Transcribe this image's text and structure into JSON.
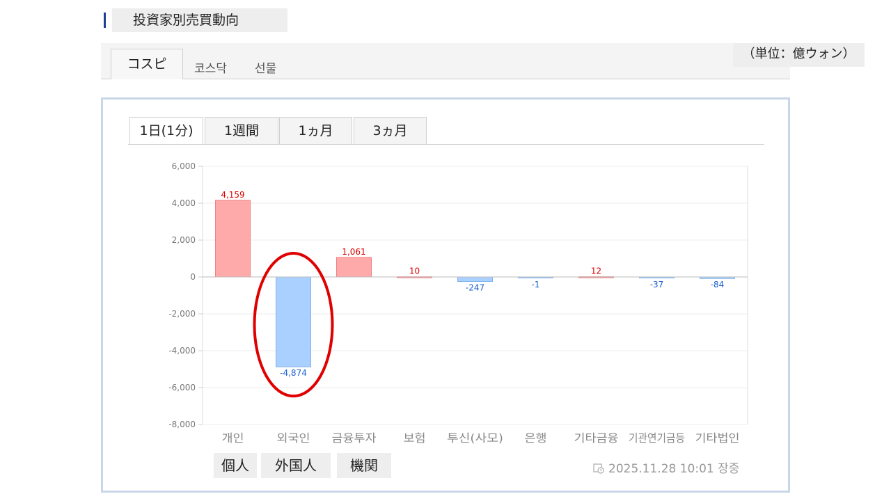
{
  "title": "投資家別売買動向",
  "unit_label": "（単位：億ウォン）",
  "market_tabs": [
    {
      "label": "コスピ",
      "active": true
    },
    {
      "label": "코스닥",
      "active": false
    },
    {
      "label": "선물",
      "active": false
    }
  ],
  "period_tabs": [
    {
      "label": "1日(1分)",
      "active": true
    },
    {
      "label": "1週間",
      "active": false
    },
    {
      "label": "1ヵ月",
      "active": false
    },
    {
      "label": "3ヵ月",
      "active": false
    }
  ],
  "footer_labels": [
    "個人",
    "外国人",
    "機関"
  ],
  "timestamp": "2025.11.28 10:01 장중",
  "colors": {
    "positive_fill": "#ffaaaa",
    "positive_stroke": "#f08080",
    "positive_text": "#e00000",
    "negative_fill": "#aad0ff",
    "negative_stroke": "#7fb2ee",
    "negative_text": "#1a5fd0",
    "highlight": "#e00000"
  },
  "chart_data": {
    "type": "bar",
    "categories": [
      "개인",
      "외국인",
      "금융투자",
      "보험",
      "투신(사모)",
      "은행",
      "기타금융",
      "기관연기금등",
      "기타법인"
    ],
    "values": [
      4159,
      -4874,
      1061,
      10,
      -247,
      -1,
      12,
      -37,
      -84
    ],
    "value_labels": [
      "4,159",
      "-4,874",
      "1,061",
      "10",
      "-247",
      "-1",
      "12",
      "-37",
      "-84"
    ],
    "y_ticks": [
      "6,000",
      "4,000",
      "2,000",
      "0",
      "-2,000",
      "-4,000",
      "-6,000",
      "-8,000"
    ],
    "ylim": [
      -8000,
      6000
    ],
    "grid": true,
    "highlighted_category": "외국인"
  }
}
